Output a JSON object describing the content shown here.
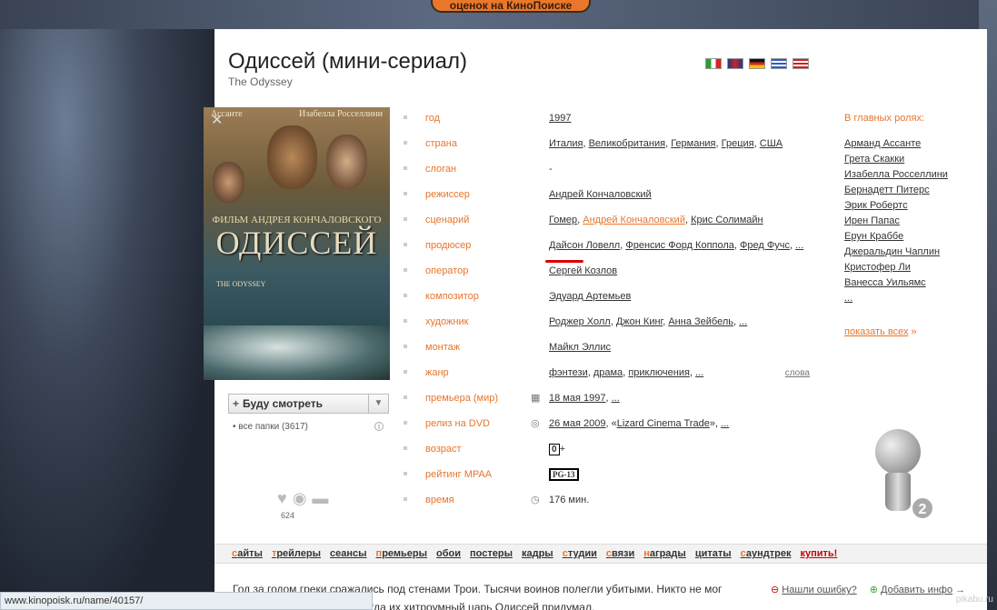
{
  "banner": "оценок на КиноПоиске",
  "title": "Одиссей (мини-сериал)",
  "original_title": "The Odyssey",
  "poster": {
    "actor_left": "Ассанте",
    "actor_right": "Изабелла Росселлини",
    "film_by": "ФИЛЬМ АНДРЕЯ КОНЧАЛОВСКОГО",
    "title": "ОДИССЕЙ",
    "subtitle": "THE ODYSSEY"
  },
  "watch_button": "Буду смотреть",
  "folders": "все папки (3617)",
  "social_count": "624",
  "info_rows": [
    {
      "label": "год",
      "value": [
        {
          "t": "1997",
          "link": true
        }
      ]
    },
    {
      "label": "страна",
      "value": [
        {
          "t": "Италия",
          "link": true
        },
        {
          "t": ", "
        },
        {
          "t": "Великобритания",
          "link": true
        },
        {
          "t": ", "
        },
        {
          "t": "Германия",
          "link": true
        },
        {
          "t": ", "
        },
        {
          "t": "Греция",
          "link": true
        },
        {
          "t": ", "
        },
        {
          "t": "США",
          "link": true
        }
      ]
    },
    {
      "label": "слоган",
      "value": [
        {
          "t": "-"
        }
      ]
    },
    {
      "label": "режиссер",
      "value": [
        {
          "t": "Андрей Кончаловский",
          "link": true
        }
      ]
    },
    {
      "label": "сценарий",
      "value": [
        {
          "t": "Гомер",
          "link": true
        },
        {
          "t": ", "
        },
        {
          "t": "Андрей Кончаловский",
          "link": true,
          "accent": true
        },
        {
          "t": ", "
        },
        {
          "t": "Крис Солимайн",
          "link": true
        }
      ]
    },
    {
      "label": "продюсер",
      "value": [
        {
          "t": "Дайсон Ловелл",
          "link": true
        },
        {
          "t": ", "
        },
        {
          "t": "Френсис Форд Коппола",
          "link": true
        },
        {
          "t": ", "
        },
        {
          "t": "Фред Фучс",
          "link": true
        },
        {
          "t": ", "
        },
        {
          "t": "...",
          "link": true
        }
      ]
    },
    {
      "label": "оператор",
      "value": [
        {
          "t": "Сергей Козлов",
          "link": true
        }
      ]
    },
    {
      "label": "композитор",
      "value": [
        {
          "t": "Эдуард Артемьев",
          "link": true
        }
      ]
    },
    {
      "label": "художник",
      "value": [
        {
          "t": "Роджер Холл",
          "link": true
        },
        {
          "t": ", "
        },
        {
          "t": "Джон Кинг",
          "link": true
        },
        {
          "t": ", "
        },
        {
          "t": "Анна Зейбель",
          "link": true
        },
        {
          "t": ", "
        },
        {
          "t": "...",
          "link": true
        }
      ]
    },
    {
      "label": "монтаж",
      "value": [
        {
          "t": "Майкл Эллис",
          "link": true
        }
      ]
    },
    {
      "label": "жанр",
      "value": [
        {
          "t": "фэнтези",
          "link": true
        },
        {
          "t": ", "
        },
        {
          "t": "драма",
          "link": true
        },
        {
          "t": ", "
        },
        {
          "t": "приключения",
          "link": true
        },
        {
          "t": ", "
        },
        {
          "t": "...",
          "link": true
        }
      ],
      "extra": "слова"
    },
    {
      "label": "премьера (мир)",
      "icon": "calendar-icon",
      "value": [
        {
          "t": "18 мая 1997",
          "link": true
        },
        {
          "t": ", "
        },
        {
          "t": "...",
          "link": true
        }
      ]
    },
    {
      "label": "релиз на DVD",
      "icon": "dvd-icon",
      "value": [
        {
          "t": "26 мая 2009",
          "link": true
        },
        {
          "t": ", «"
        },
        {
          "t": "Lizard Cinema Trade",
          "link": true
        },
        {
          "t": "», "
        },
        {
          "t": "...",
          "link": true
        }
      ]
    },
    {
      "label": "возраст",
      "value": [
        {
          "t": "0",
          "box": "age"
        },
        {
          "t": "+"
        }
      ]
    },
    {
      "label": "рейтинг MPAA",
      "value": [
        {
          "t": "PG-13",
          "box": "mpaa"
        }
      ]
    },
    {
      "label": "время",
      "icon": "clock-icon",
      "value": [
        {
          "t": "176 мин."
        }
      ]
    }
  ],
  "cast": {
    "title": "В главных ролях:",
    "items": [
      "Арманд Ассанте",
      "Грета Скакки",
      "Изабелла Росселлини",
      "Бернадетт Питерс",
      "Эрик Робертс",
      "Ирен Папас",
      "Ерун Краббе",
      "Джеральдин Чаплин",
      "Кристофер Ли",
      "Ванесса Уильямс",
      "..."
    ],
    "more": "показать всех",
    "more_arrow": "»"
  },
  "award_count": "2",
  "tabs": [
    {
      "first": "с",
      "rest": "айты",
      "style": "gray"
    },
    {
      "first": "т",
      "rest": "рейлеры",
      "style": "dark"
    },
    {
      "first": "",
      "rest": "сеансы",
      "style": "gray"
    },
    {
      "first": "п",
      "rest": "ремьеры",
      "style": "dark"
    },
    {
      "first": "",
      "rest": "обои",
      "style": "gray"
    },
    {
      "first": "",
      "rest": "постеры",
      "style": "gray"
    },
    {
      "first": "",
      "rest": "кадры",
      "style": "gray"
    },
    {
      "first": "с",
      "rest": "тудии",
      "style": "dark"
    },
    {
      "first": "с",
      "rest": "вязи",
      "style": "dark"
    },
    {
      "first": "н",
      "rest": "аграды",
      "style": "dark"
    },
    {
      "first": "",
      "rest": "цитаты",
      "style": "gray"
    },
    {
      "first": "с",
      "rest": "аундтрек",
      "style": "dark"
    },
    {
      "first": "",
      "rest": "купить!",
      "style": "red"
    }
  ],
  "description": "Год за годом греки сражались под стенами Трои. Тысячи воинов полегли убитыми. Никто не мог одолеть. Греки роптали. Тогда их хитроумный царь Одиссей придумал,",
  "actions": {
    "error": "Нашли ошибку?",
    "add": "Добавить инфо",
    "add_arrow": "→"
  },
  "status_url": "www.kinopoisk.ru/name/40157/",
  "watermark": "pikabu.ru"
}
